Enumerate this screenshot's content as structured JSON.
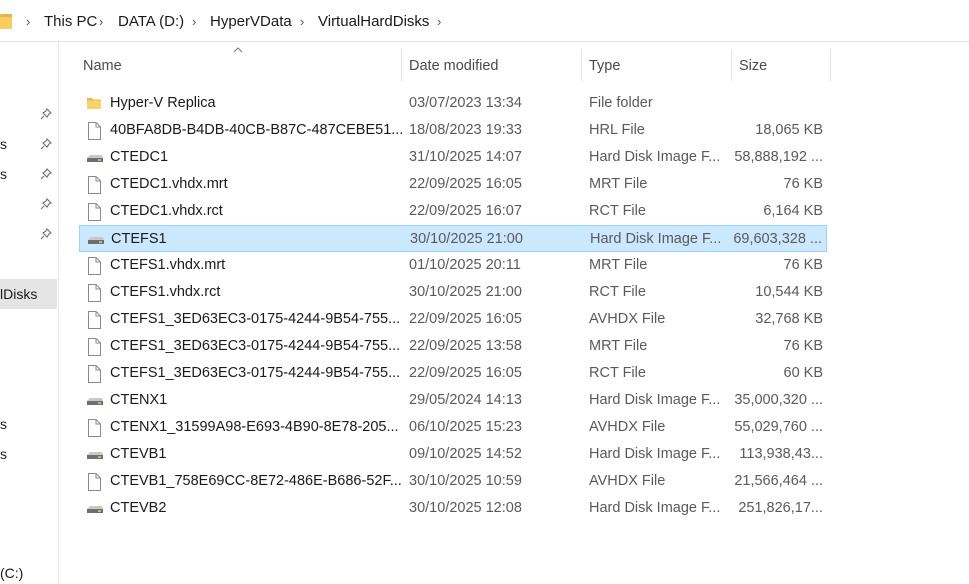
{
  "breadcrumb": [
    "This PC",
    "DATA (D:)",
    "HyperVData",
    "VirtualHardDisks"
  ],
  "nav": {
    "selected_item": "lDisks",
    "partial_items": [
      "s",
      "s",
      "s",
      "s"
    ],
    "drive_partial": "(C:)"
  },
  "columns": {
    "name": "Name",
    "date": "Date modified",
    "type": "Type",
    "size": "Size"
  },
  "files": [
    {
      "name": "Hyper-V Replica",
      "date": "03/07/2023 13:34",
      "type": "File folder",
      "size": "",
      "icon": "folder-icon"
    },
    {
      "name": "40BFA8DB-B4DB-40CB-B87C-487CEBE51...",
      "date": "18/08/2023 19:33",
      "type": "HRL File",
      "size": "18,065 KB",
      "icon": "file-icon"
    },
    {
      "name": "CTEDC1",
      "date": "31/10/2025 14:07",
      "type": "Hard Disk Image F...",
      "size": "58,888,192 ...",
      "icon": "disk-image-icon"
    },
    {
      "name": "CTEDC1.vhdx.mrt",
      "date": "22/09/2025 16:05",
      "type": "MRT File",
      "size": "76 KB",
      "icon": "file-icon"
    },
    {
      "name": "CTEDC1.vhdx.rct",
      "date": "22/09/2025 16:07",
      "type": "RCT File",
      "size": "6,164 KB",
      "icon": "file-icon"
    },
    {
      "name": "CTEFS1",
      "date": "30/10/2025 21:00",
      "type": "Hard Disk Image F...",
      "size": "69,603,328 ...",
      "icon": "disk-image-icon",
      "selected": true
    },
    {
      "name": "CTEFS1.vhdx.mrt",
      "date": "01/10/2025 20:11",
      "type": "MRT File",
      "size": "76 KB",
      "icon": "file-icon"
    },
    {
      "name": "CTEFS1.vhdx.rct",
      "date": "30/10/2025 21:00",
      "type": "RCT File",
      "size": "10,544 KB",
      "icon": "file-icon"
    },
    {
      "name": "CTEFS1_3ED63EC3-0175-4244-9B54-755...",
      "date": "22/09/2025 16:05",
      "type": "AVHDX File",
      "size": "32,768 KB",
      "icon": "file-icon"
    },
    {
      "name": "CTEFS1_3ED63EC3-0175-4244-9B54-755...",
      "date": "22/09/2025 13:58",
      "type": "MRT File",
      "size": "76 KB",
      "icon": "file-icon"
    },
    {
      "name": "CTEFS1_3ED63EC3-0175-4244-9B54-755...",
      "date": "22/09/2025 16:05",
      "type": "RCT File",
      "size": "60 KB",
      "icon": "file-icon"
    },
    {
      "name": "CTENX1",
      "date": "29/05/2024 14:13",
      "type": "Hard Disk Image F...",
      "size": "35,000,320 ...",
      "icon": "disk-image-icon"
    },
    {
      "name": "CTENX1_31599A98-E693-4B90-8E78-205...",
      "date": "06/10/2025 15:23",
      "type": "AVHDX File",
      "size": "55,029,760 ...",
      "icon": "file-icon"
    },
    {
      "name": "CTEVB1",
      "date": "09/10/2025 14:52",
      "type": "Hard Disk Image F...",
      "size": "113,938,43...",
      "icon": "disk-image-icon"
    },
    {
      "name": "CTEVB1_758E69CC-8E72-486E-B686-52F...",
      "date": "30/10/2025 10:59",
      "type": "AVHDX File",
      "size": "21,566,464 ...",
      "icon": "file-icon"
    },
    {
      "name": "CTEVB2",
      "date": "30/10/2025 12:08",
      "type": "Hard Disk Image F...",
      "size": "251,826,17...",
      "icon": "disk-image-icon"
    }
  ]
}
